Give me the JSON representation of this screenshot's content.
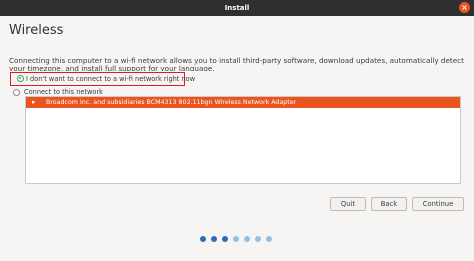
{
  "window": {
    "title": "Install",
    "close_symbol": "×"
  },
  "page": {
    "heading": "Wireless",
    "description": "Connecting this computer to a wi-fi network allows you to install third-party software, download updates, automatically detect your timezone, and install full support for your language."
  },
  "options": {
    "no_connect": {
      "label": "I don't want to connect to a wi-fi network right now",
      "selected": true
    },
    "connect": {
      "label": "Connect to this network",
      "selected": false
    }
  },
  "network_list": {
    "items": [
      {
        "label": "Broadcom Inc. and subsidiaries BCM4313 802.11bgn Wireless Network Adapter",
        "arrow": "▸",
        "selected": true
      }
    ]
  },
  "buttons": {
    "quit": "Quit",
    "back": "Back",
    "continue": "Continue"
  },
  "progress": {
    "total_steps": 7,
    "current_step": 3,
    "colors": {
      "done": "#2a6fb5",
      "todo": "#8ec3e6"
    }
  },
  "colors": {
    "accent": "#e9541f",
    "selection_outline": "#d81e1e",
    "radio_selected": "#34a853"
  }
}
